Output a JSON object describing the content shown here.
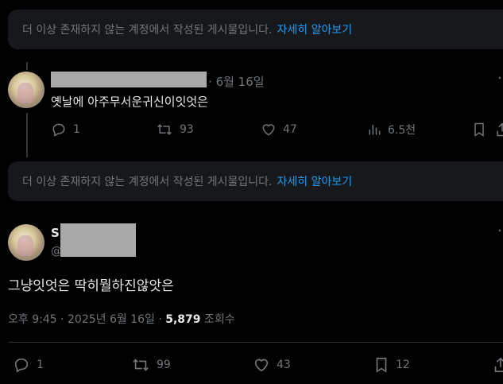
{
  "notices": [
    {
      "text": "더 이상 존재하지 않는 계정에서 작성된 게시물입니다.",
      "link": "자세히 알아보기"
    },
    {
      "text": "더 이상 존재하지 않는 계정에서 작성된 게시물입니다.",
      "link": "자세히 알아보기"
    }
  ],
  "reply_post": {
    "date_separator": "·",
    "date": "6월 16일",
    "text": "옛날에 아주무서운귀신이잇엇은",
    "replies": "1",
    "reposts": "93",
    "likes": "47",
    "views": "6.5천"
  },
  "main_post": {
    "name_initial": "S",
    "handle_prefix": "@",
    "text": "그냥잇엇은 딱히뭘하진않앗은",
    "time": "오후 9:45 · 2025년 6월 16일 ·",
    "views_count": "5,879",
    "views_label": "조회수",
    "replies": "1",
    "reposts": "99",
    "likes": "43",
    "bookmarks": "12"
  },
  "colors": {
    "background": "#000000",
    "card": "#16181c",
    "link": "#1d9bf0",
    "muted": "#71767b",
    "text": "#e7e9ea"
  }
}
